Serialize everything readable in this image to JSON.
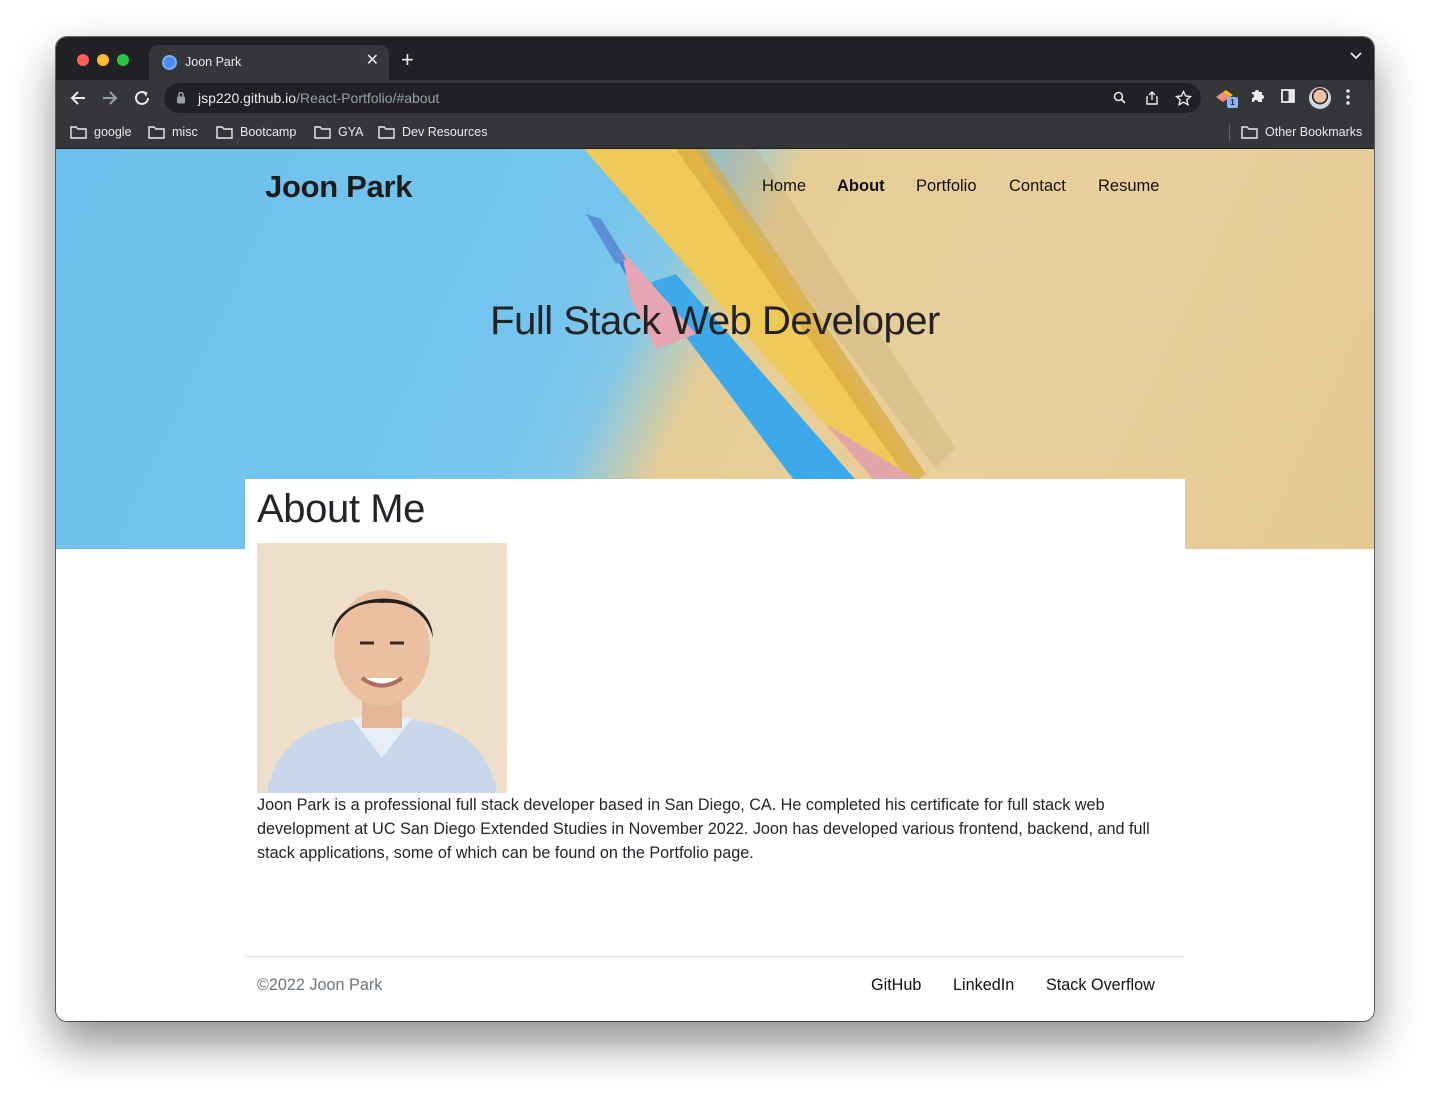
{
  "browser": {
    "tab_title": "Joon Park",
    "url_host": "jsp220.github.io",
    "url_path": "/React-Portfolio/#about",
    "extension_badge": "1",
    "bookmarks": [
      "google",
      "misc",
      "Bootcamp",
      "GYA",
      "Dev Resources"
    ],
    "other_bookmarks": "Other Bookmarks"
  },
  "site": {
    "brand": "Joon Park",
    "nav": [
      "Home",
      "About",
      "Portfolio",
      "Contact",
      "Resume"
    ],
    "active_nav": "About",
    "hero_title": "Full Stack Web Developer"
  },
  "about": {
    "heading": "About Me",
    "text": "Joon Park is a professional full stack developer based in San Diego, CA. He completed his certificate for full stack web development at UC San Diego Extended Studies in November 2022. Joon has developed various frontend, backend, and full stack applications, some of which can be found on the Portfolio page."
  },
  "footer": {
    "copyright": "©2022 Joon Park",
    "links": [
      "GitHub",
      "LinkedIn",
      "Stack Overflow"
    ]
  },
  "colors": {
    "hero_blue": "#74c4ee",
    "hero_tan": "#e8cf9c",
    "chrome_dark": "#202124",
    "chrome_toolbar": "#35363a"
  }
}
